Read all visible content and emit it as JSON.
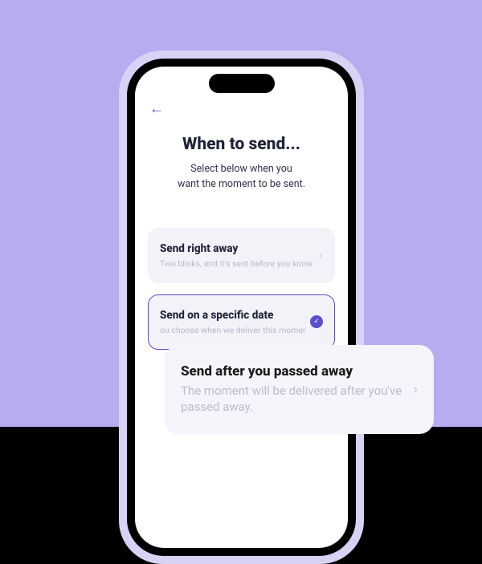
{
  "header": {
    "back_glyph": "←",
    "title": "When to send...",
    "subtitle_line1": "Select below when you",
    "subtitle_line2": "want the moment to be sent."
  },
  "options": {
    "right_away": {
      "title": "Send right away",
      "sub": "Two blinks, and it's sent before you know it."
    },
    "specific_date": {
      "title": "Send on a specific date",
      "sub": "ou choose when we deliver this moment."
    },
    "passed_away": {
      "title": "Send after you passed away",
      "sub": "The moment will be delivered after you've passed away."
    }
  },
  "glyphs": {
    "chevron": "›",
    "check": "✓"
  }
}
